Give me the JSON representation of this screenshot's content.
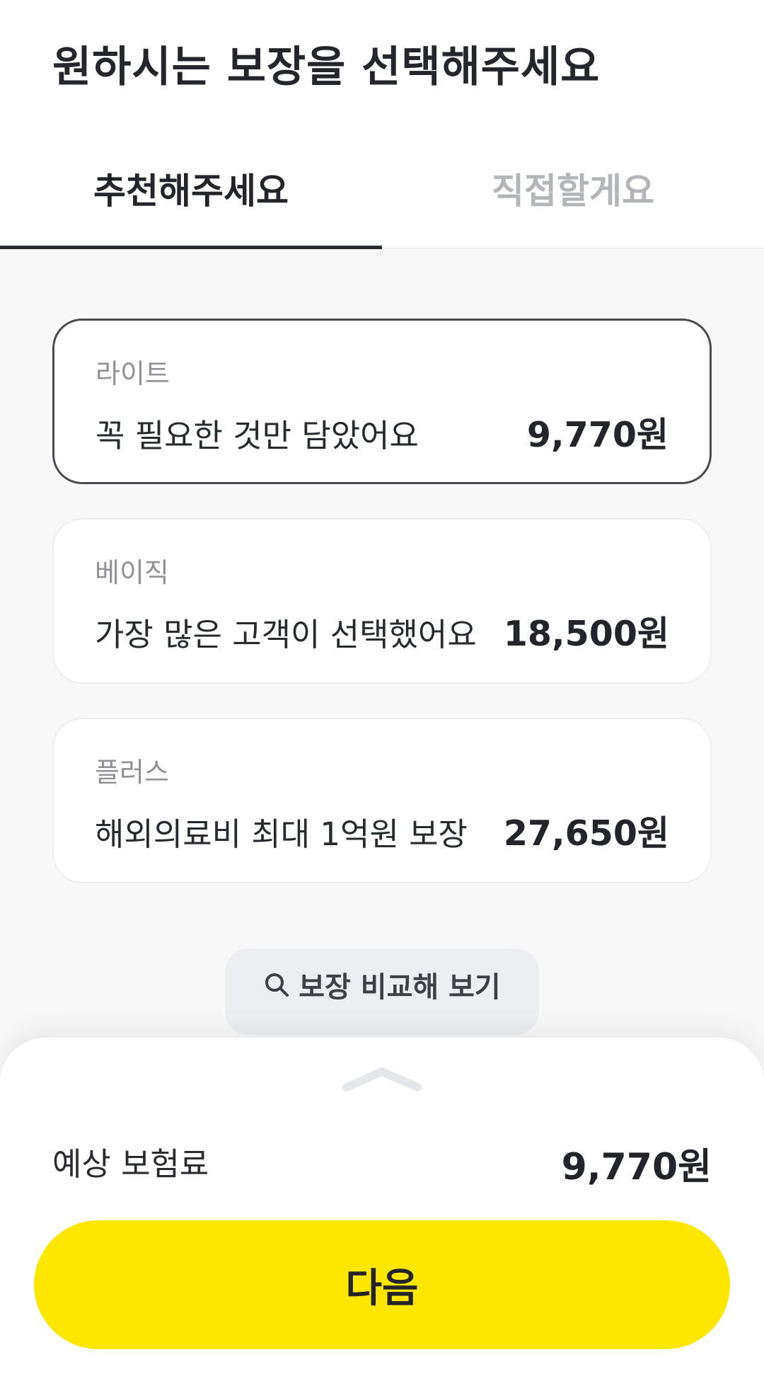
{
  "header": {
    "title": "원하시는 보장을 선택해주세요"
  },
  "tabs": [
    {
      "label": "추천해주세요",
      "active": true
    },
    {
      "label": "직접할게요",
      "active": false
    }
  ],
  "plans": [
    {
      "name": "라이트",
      "description": "꼭 필요한 것만 담았어요",
      "price": "9,770원",
      "selected": true
    },
    {
      "name": "베이직",
      "description": "가장 많은 고객이 선택했어요",
      "price": "18,500원",
      "selected": false
    },
    {
      "name": "플러스",
      "description": "해외의료비 최대 1억원 보장",
      "price": "27,650원",
      "selected": false
    }
  ],
  "compare": {
    "icon": "search-icon",
    "label": "보장 비교해 보기"
  },
  "summary": {
    "handle_icon": "chevron-up-icon",
    "label": "예상 보험료",
    "value": "9,770원"
  },
  "next_button": {
    "label": "다음"
  },
  "colors": {
    "accent": "#fde600",
    "text": "#222429",
    "muted": "#8f9196",
    "inactive_tab": "#b3b5b9",
    "background": "#f8f8f9"
  }
}
